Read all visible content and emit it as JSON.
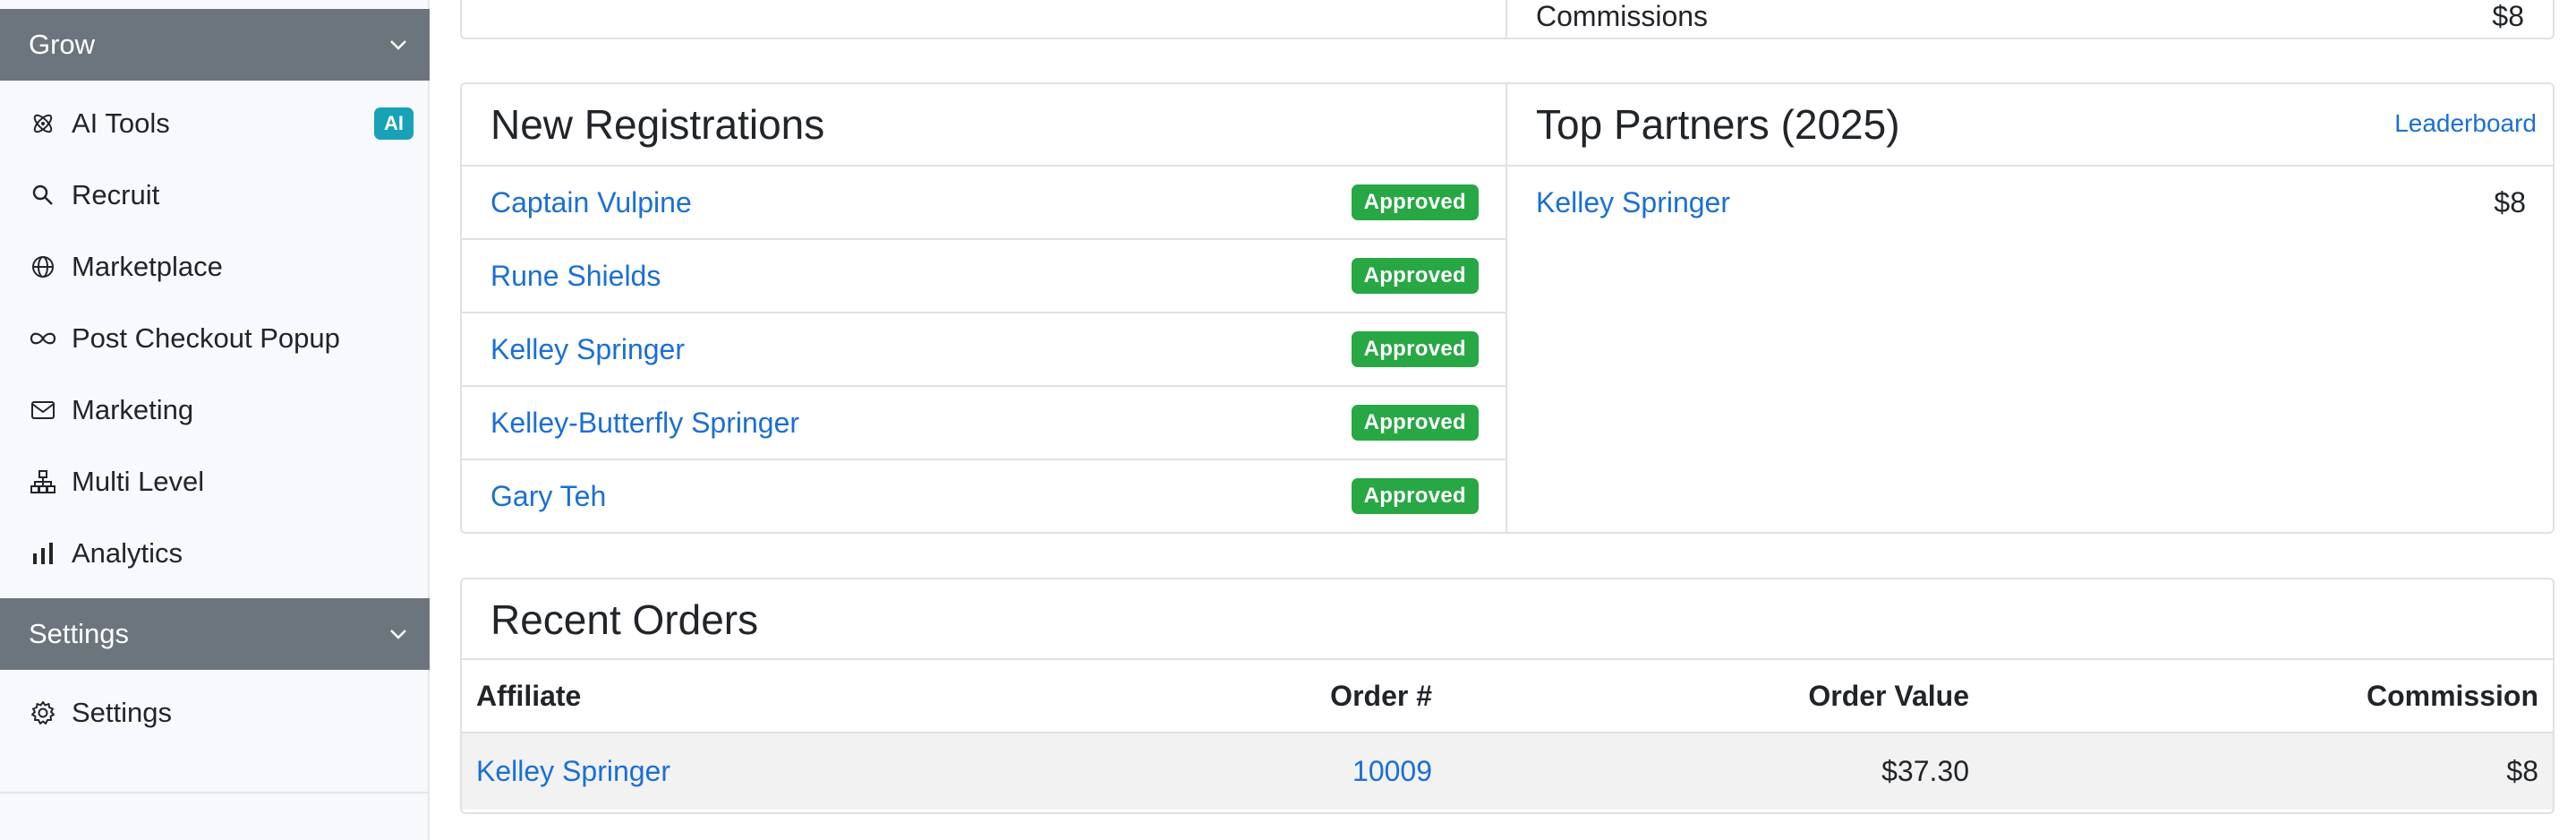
{
  "sidebar": {
    "grow_header": "Grow",
    "items": [
      {
        "label": "AI Tools",
        "icon": "atom-icon",
        "badge": "AI"
      },
      {
        "label": "Recruit",
        "icon": "search-icon"
      },
      {
        "label": "Marketplace",
        "icon": "globe-icon"
      },
      {
        "label": "Post Checkout Popup",
        "icon": "infinity-icon"
      },
      {
        "label": "Marketing",
        "icon": "envelope-icon"
      },
      {
        "label": "Multi Level",
        "icon": "hierarchy-icon"
      },
      {
        "label": "Analytics",
        "icon": "bar-chart-icon"
      }
    ],
    "settings_header": "Settings",
    "settings_items": [
      {
        "label": "Settings",
        "icon": "gear-icon"
      }
    ]
  },
  "top_card": {
    "label": "Commissions",
    "value": "$8"
  },
  "new_registrations": {
    "title": "New Registrations",
    "rows": [
      {
        "name": "Captain Vulpine",
        "status": "Approved"
      },
      {
        "name": "Rune Shields",
        "status": "Approved"
      },
      {
        "name": "Kelley Springer",
        "status": "Approved"
      },
      {
        "name": "Kelley-Butterfly Springer",
        "status": "Approved"
      },
      {
        "name": "Gary Teh",
        "status": "Approved"
      }
    ]
  },
  "top_partners": {
    "title": "Top Partners (2025)",
    "leaderboard_link": "Leaderboard",
    "rows": [
      {
        "name": "Kelley Springer",
        "amount": "$8"
      }
    ]
  },
  "recent_orders": {
    "title": "Recent Orders",
    "columns": [
      "Affiliate",
      "Order #",
      "Order Value",
      "Commission"
    ],
    "rows": [
      {
        "affiliate": "Kelley Springer",
        "order_no": "10009",
        "order_value": "$37.30",
        "commission": "$8"
      }
    ]
  },
  "colors": {
    "section_header_bg": "#6c757d",
    "link": "#1a6fd4",
    "approved_badge": "#28a745",
    "ai_badge": "#17a2b8"
  }
}
